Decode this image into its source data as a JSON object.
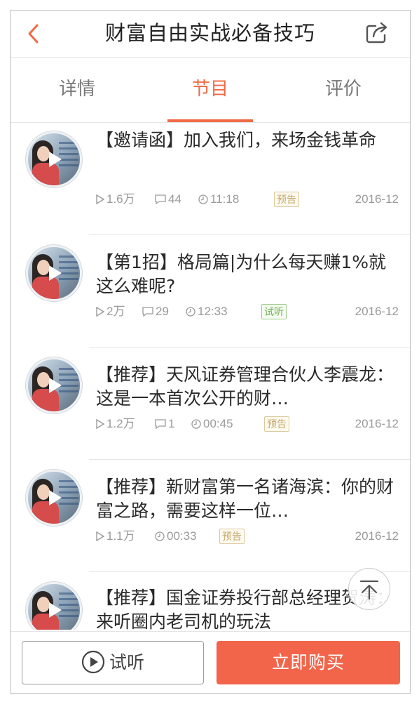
{
  "header": {
    "title": "财富自由实战必备技巧",
    "back_icon": "chevron-left-icon",
    "share_icon": "share-icon",
    "accent": "#f06a45"
  },
  "tabs": [
    {
      "label": "详情",
      "active": false
    },
    {
      "label": "节目",
      "active": true
    },
    {
      "label": "评价",
      "active": false
    }
  ],
  "episodes": [
    {
      "title": "【邀请函】加入我们，来场金钱革命",
      "plays": "1.6万",
      "comments": "44",
      "duration": "11:18",
      "badge": "预告",
      "badge_type": "preview",
      "date": "2016-12"
    },
    {
      "title": "【第1招】格局篇|为什么每天赚1%就这么难呢?",
      "plays": "2万",
      "comments": "29",
      "duration": "12:33",
      "badge": "试听",
      "badge_type": "trial",
      "date": "2016-12"
    },
    {
      "title": "【推荐】天风证券管理合伙人李震龙：这是一本首次公开的财…",
      "plays": "1.2万",
      "comments": "1",
      "duration": "00:45",
      "badge": "预告",
      "badge_type": "preview",
      "date": "2016-12"
    },
    {
      "title": "【推荐】新财富第一名诸海滨：你的财富之路，需要这样一位…",
      "plays": "1.1万",
      "comments": "",
      "duration": "00:33",
      "badge": "预告",
      "badge_type": "preview",
      "date": "2016-12"
    },
    {
      "title": "【推荐】国金证券投行部总经理贺涛：来听圈内老司机的玩法",
      "plays": "",
      "comments": "",
      "duration": "",
      "badge": "",
      "badge_type": "",
      "date": ""
    }
  ],
  "back_to_top_icon": "arrow-up-to-top-icon",
  "bottom": {
    "listen_label": "试听",
    "buy_label": "立即购买",
    "buy_color": "#f2654a"
  }
}
